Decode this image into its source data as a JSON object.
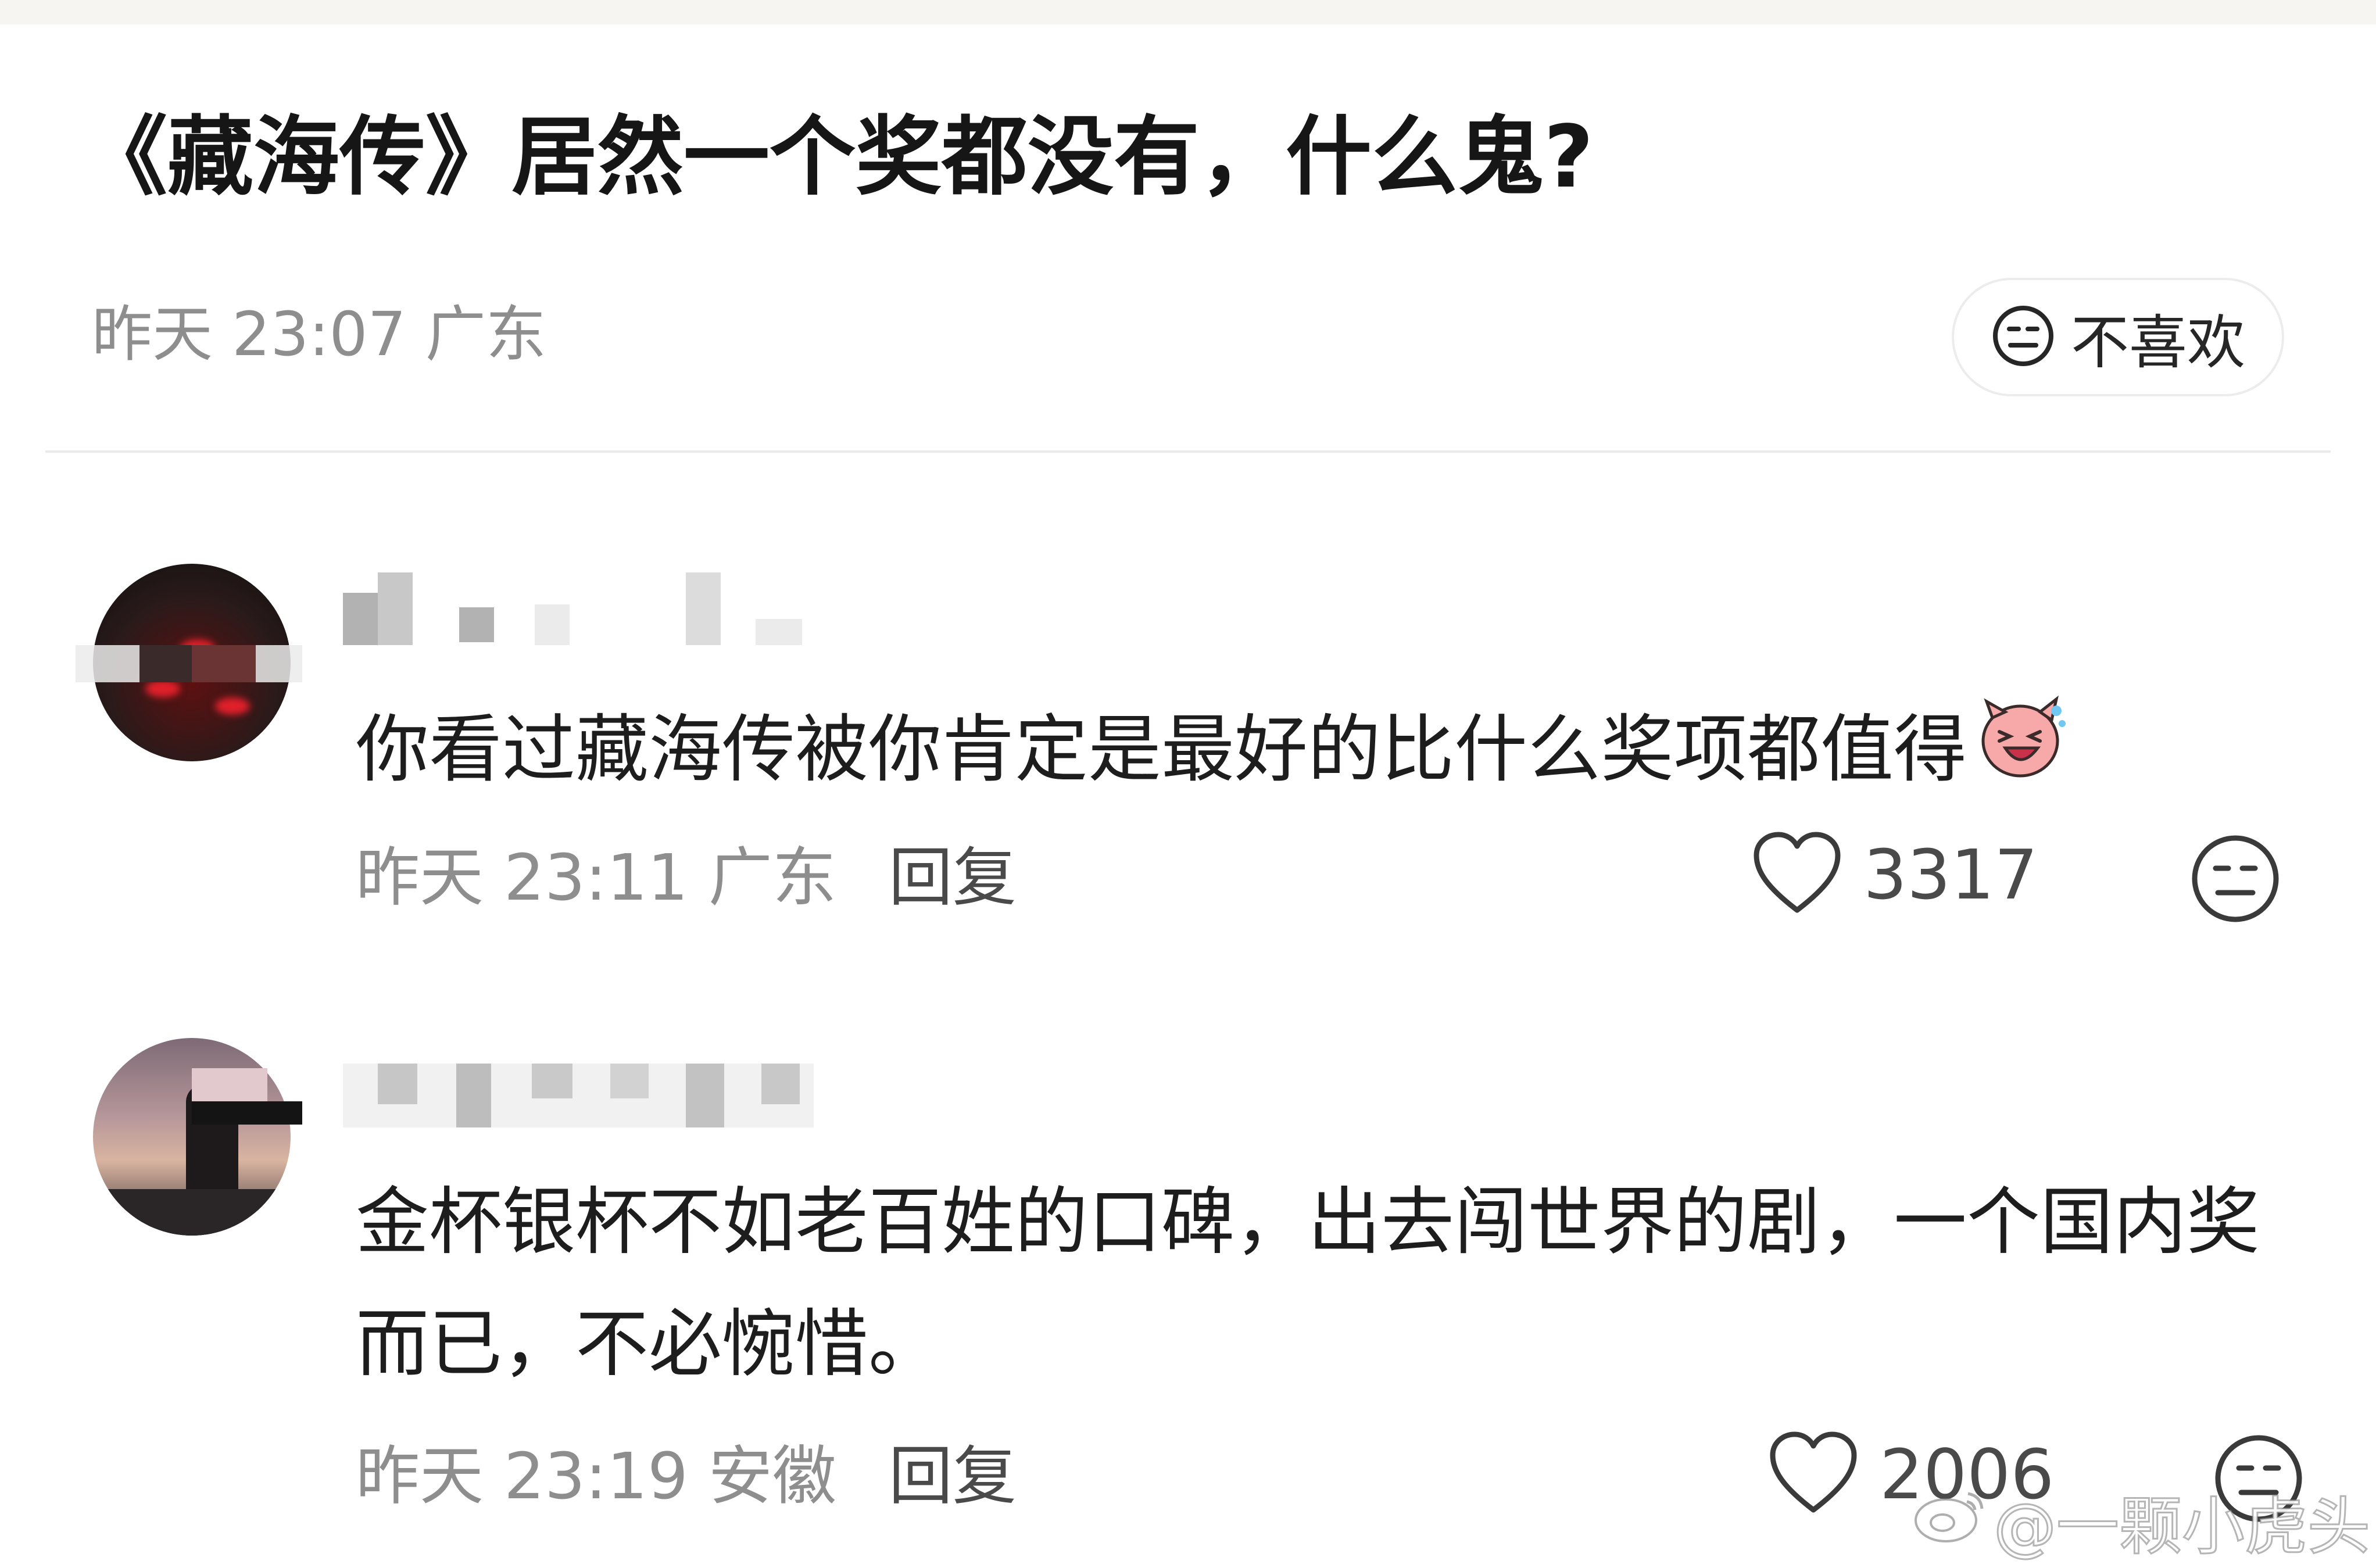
{
  "post": {
    "title": "《藏海传》居然一个奖都没有，什么鬼?",
    "meta": "昨天 23:07 广东",
    "dislike_label": "不喜欢"
  },
  "comments": [
    {
      "text": "你看过藏海传被你肯定是最好的比什么奖项都值得",
      "emoji": "laughing-pig-emoji",
      "meta": "昨天 23:11 广东",
      "reply_label": "回复",
      "likes": "3317"
    },
    {
      "text": "金杯银杯不如老百姓的口碑，出去闯世界的剧，一个国内奖而已，不必惋惜。",
      "meta": "昨天 23:19 安徽",
      "reply_label": "回复",
      "likes": "2006"
    }
  ],
  "watermark": {
    "text": "@一颗小虎头",
    "icon": "weibo-icon"
  },
  "icons": {
    "dislike": "neutral-face-icon",
    "like": "heart-outline-icon"
  },
  "colors": {
    "title": "#161616",
    "meta": "#8e8e8e",
    "reply": "#4a4a4a",
    "divider": "#ebebeb"
  }
}
